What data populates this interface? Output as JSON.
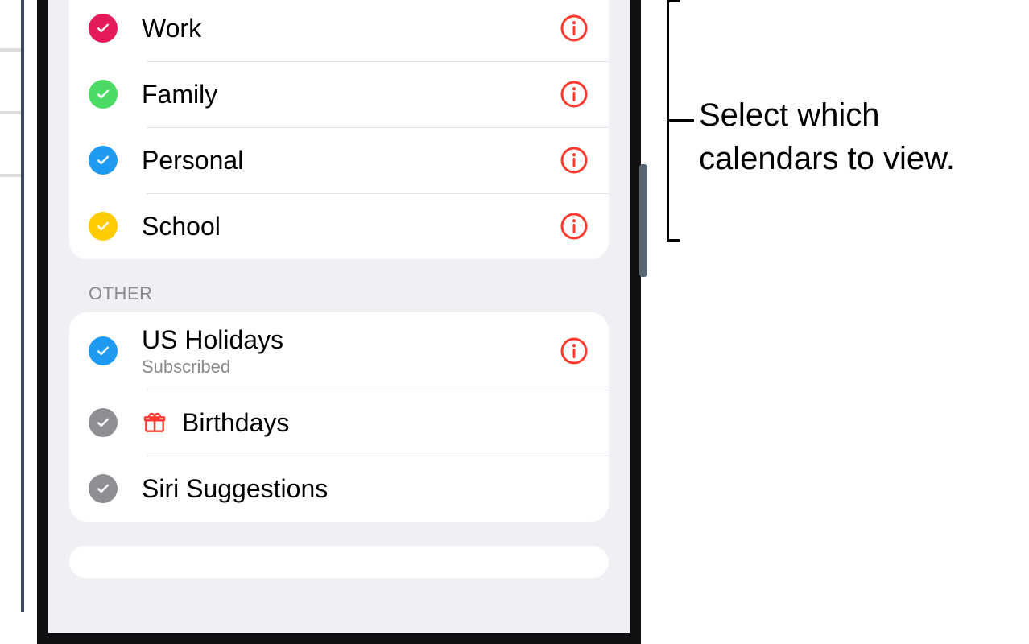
{
  "sections": {
    "main": {
      "items": [
        {
          "label": "Work",
          "color": "#e51a5b"
        },
        {
          "label": "Family",
          "color": "#4cd964"
        },
        {
          "label": "Personal",
          "color": "#1e9bf0"
        },
        {
          "label": "School",
          "color": "#ffcc00"
        }
      ]
    },
    "other": {
      "header": "OTHER",
      "items": [
        {
          "label": "US Holidays",
          "sublabel": "Subscribed",
          "color": "#1e9bf0"
        },
        {
          "label": "Birthdays",
          "color": "#8e8e93",
          "icon": "gift"
        },
        {
          "label": "Siri Suggestions",
          "color": "#8e8e93"
        }
      ]
    }
  },
  "callout": {
    "text": "Select which\ncalendars to view."
  }
}
